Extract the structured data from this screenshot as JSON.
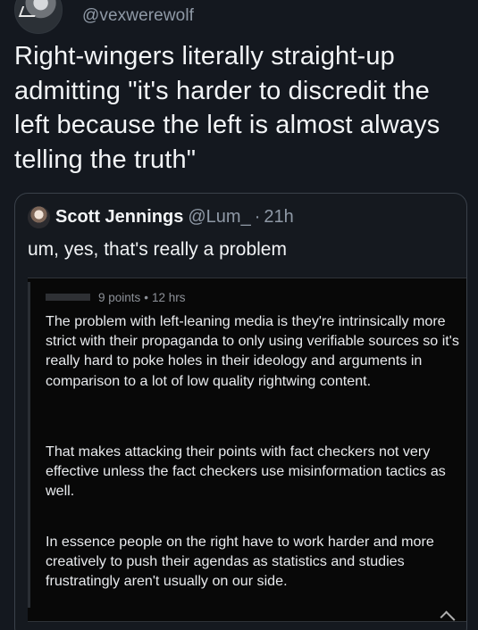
{
  "header": {
    "handle": "@vexwerewolf"
  },
  "tweet": {
    "text": "Right-wingers literally straight-up admitting \"it's harder to discredit the left because the left is almost always telling the truth\""
  },
  "quote": {
    "name": "Scott Jennings",
    "handle": "@Lum_",
    "separator": "·",
    "time": "21h",
    "text": "um, yes, that's really a problem"
  },
  "embedded_comment": {
    "points": "9 points",
    "separator": "•",
    "time": "12 hrs",
    "paragraph_1": "The problem with left-leaning media is they're intrinsically more strict with their propaganda to only using verifiable sources so it's really hard to poke holes in their ideology and arguments in comparison to a lot of low quality rightwing content.",
    "paragraph_2": "That makes attacking their points with fact checkers not very effective unless the fact checkers use misinformation tactics as well.",
    "paragraph_3": "In essence people on the right have to work harder and more creatively to push their agendas as statistics and studies frustratingly aren't usually on our side."
  },
  "icons": {
    "top_avatar": "profile-avatar-icon",
    "quote_avatar": "profile-avatar-icon",
    "scroll_hint": "chevron-up-icon"
  }
}
